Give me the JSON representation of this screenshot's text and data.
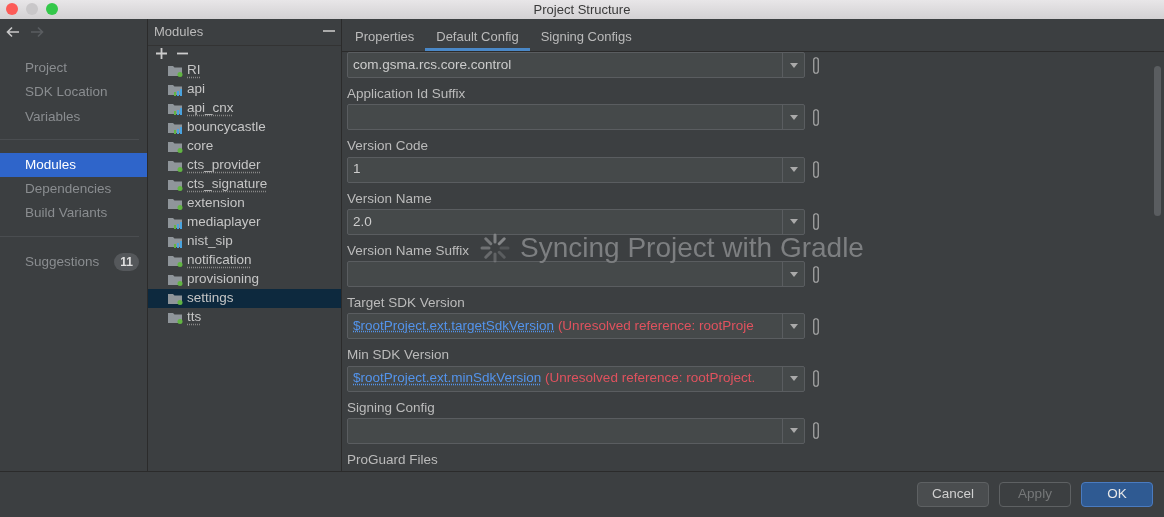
{
  "window": {
    "title": "Project Structure",
    "controls": [
      {
        "kind": "close",
        "disabled": false
      },
      {
        "kind": "minimize",
        "disabled": true
      },
      {
        "kind": "zoom",
        "disabled": false
      }
    ]
  },
  "navigation": {
    "back_disabled": false,
    "forward_disabled": true
  },
  "sidebar": {
    "groups": [
      {
        "items": [
          {
            "label": "Project",
            "selected": false
          },
          {
            "label": "SDK Location",
            "selected": false
          },
          {
            "label": "Variables",
            "selected": false
          }
        ]
      },
      {
        "items": [
          {
            "label": "Modules",
            "selected": true
          },
          {
            "label": "Dependencies",
            "selected": false
          },
          {
            "label": "Build Variants",
            "selected": false
          }
        ]
      },
      {
        "items": [
          {
            "label": "Suggestions",
            "selected": false,
            "badge": "11"
          }
        ]
      }
    ]
  },
  "modules": {
    "title": "Modules",
    "items": [
      {
        "name": "RI",
        "kind": "app",
        "flagged": true,
        "selected": false
      },
      {
        "name": "api",
        "kind": "library",
        "flagged": false,
        "selected": false
      },
      {
        "name": "api_cnx",
        "kind": "library",
        "flagged": true,
        "selected": false
      },
      {
        "name": "bouncycastle",
        "kind": "library",
        "flagged": false,
        "selected": false
      },
      {
        "name": "core",
        "kind": "app",
        "flagged": false,
        "selected": false
      },
      {
        "name": "cts_provider",
        "kind": "app",
        "flagged": true,
        "selected": false
      },
      {
        "name": "cts_signature",
        "kind": "app",
        "flagged": true,
        "selected": false
      },
      {
        "name": "extension",
        "kind": "app",
        "flagged": false,
        "selected": false
      },
      {
        "name": "mediaplayer",
        "kind": "library",
        "flagged": false,
        "selected": false
      },
      {
        "name": "nist_sip",
        "kind": "library",
        "flagged": false,
        "selected": false
      },
      {
        "name": "notification",
        "kind": "app",
        "flagged": true,
        "selected": false
      },
      {
        "name": "provisioning",
        "kind": "app",
        "flagged": false,
        "selected": false
      },
      {
        "name": "settings",
        "kind": "app",
        "flagged": false,
        "selected": true
      },
      {
        "name": "tts",
        "kind": "app",
        "flagged": true,
        "selected": false
      }
    ]
  },
  "tabs": [
    {
      "label": "Properties",
      "selected": false
    },
    {
      "label": "Default Config",
      "selected": true
    },
    {
      "label": "Signing Configs",
      "selected": false
    }
  ],
  "fields": [
    {
      "kind": "text",
      "value": "com.gsma.rcs.core.control"
    },
    {
      "kind": "text",
      "label": "Application Id Suffix"
    },
    {
      "kind": "text",
      "label": "Version Code",
      "value": "1"
    },
    {
      "kind": "text",
      "label": "Version Name",
      "value": "2.0"
    },
    {
      "kind": "text",
      "label": "Version Name Suffix"
    },
    {
      "kind": "reference",
      "label": "Target SDK Version",
      "reference": "$rootProject.ext.targetSdkVersion",
      "error": "(Unresolved reference: rootProje"
    },
    {
      "kind": "reference",
      "label": "Min SDK Version",
      "reference": "$rootProject.ext.minSdkVersion",
      "error": "(Unresolved reference: rootProject."
    },
    {
      "kind": "text",
      "label": "Signing Config"
    },
    {
      "kind": "label_only",
      "label": "ProGuard Files"
    }
  ],
  "overlay": {
    "message": "Syncing Project with Gradle"
  },
  "buttons": [
    {
      "label": "Cancel",
      "kind": "normal",
      "disabled": false
    },
    {
      "label": "Apply",
      "kind": "normal",
      "disabled": true
    },
    {
      "label": "OK",
      "kind": "default",
      "disabled": false
    }
  ]
}
